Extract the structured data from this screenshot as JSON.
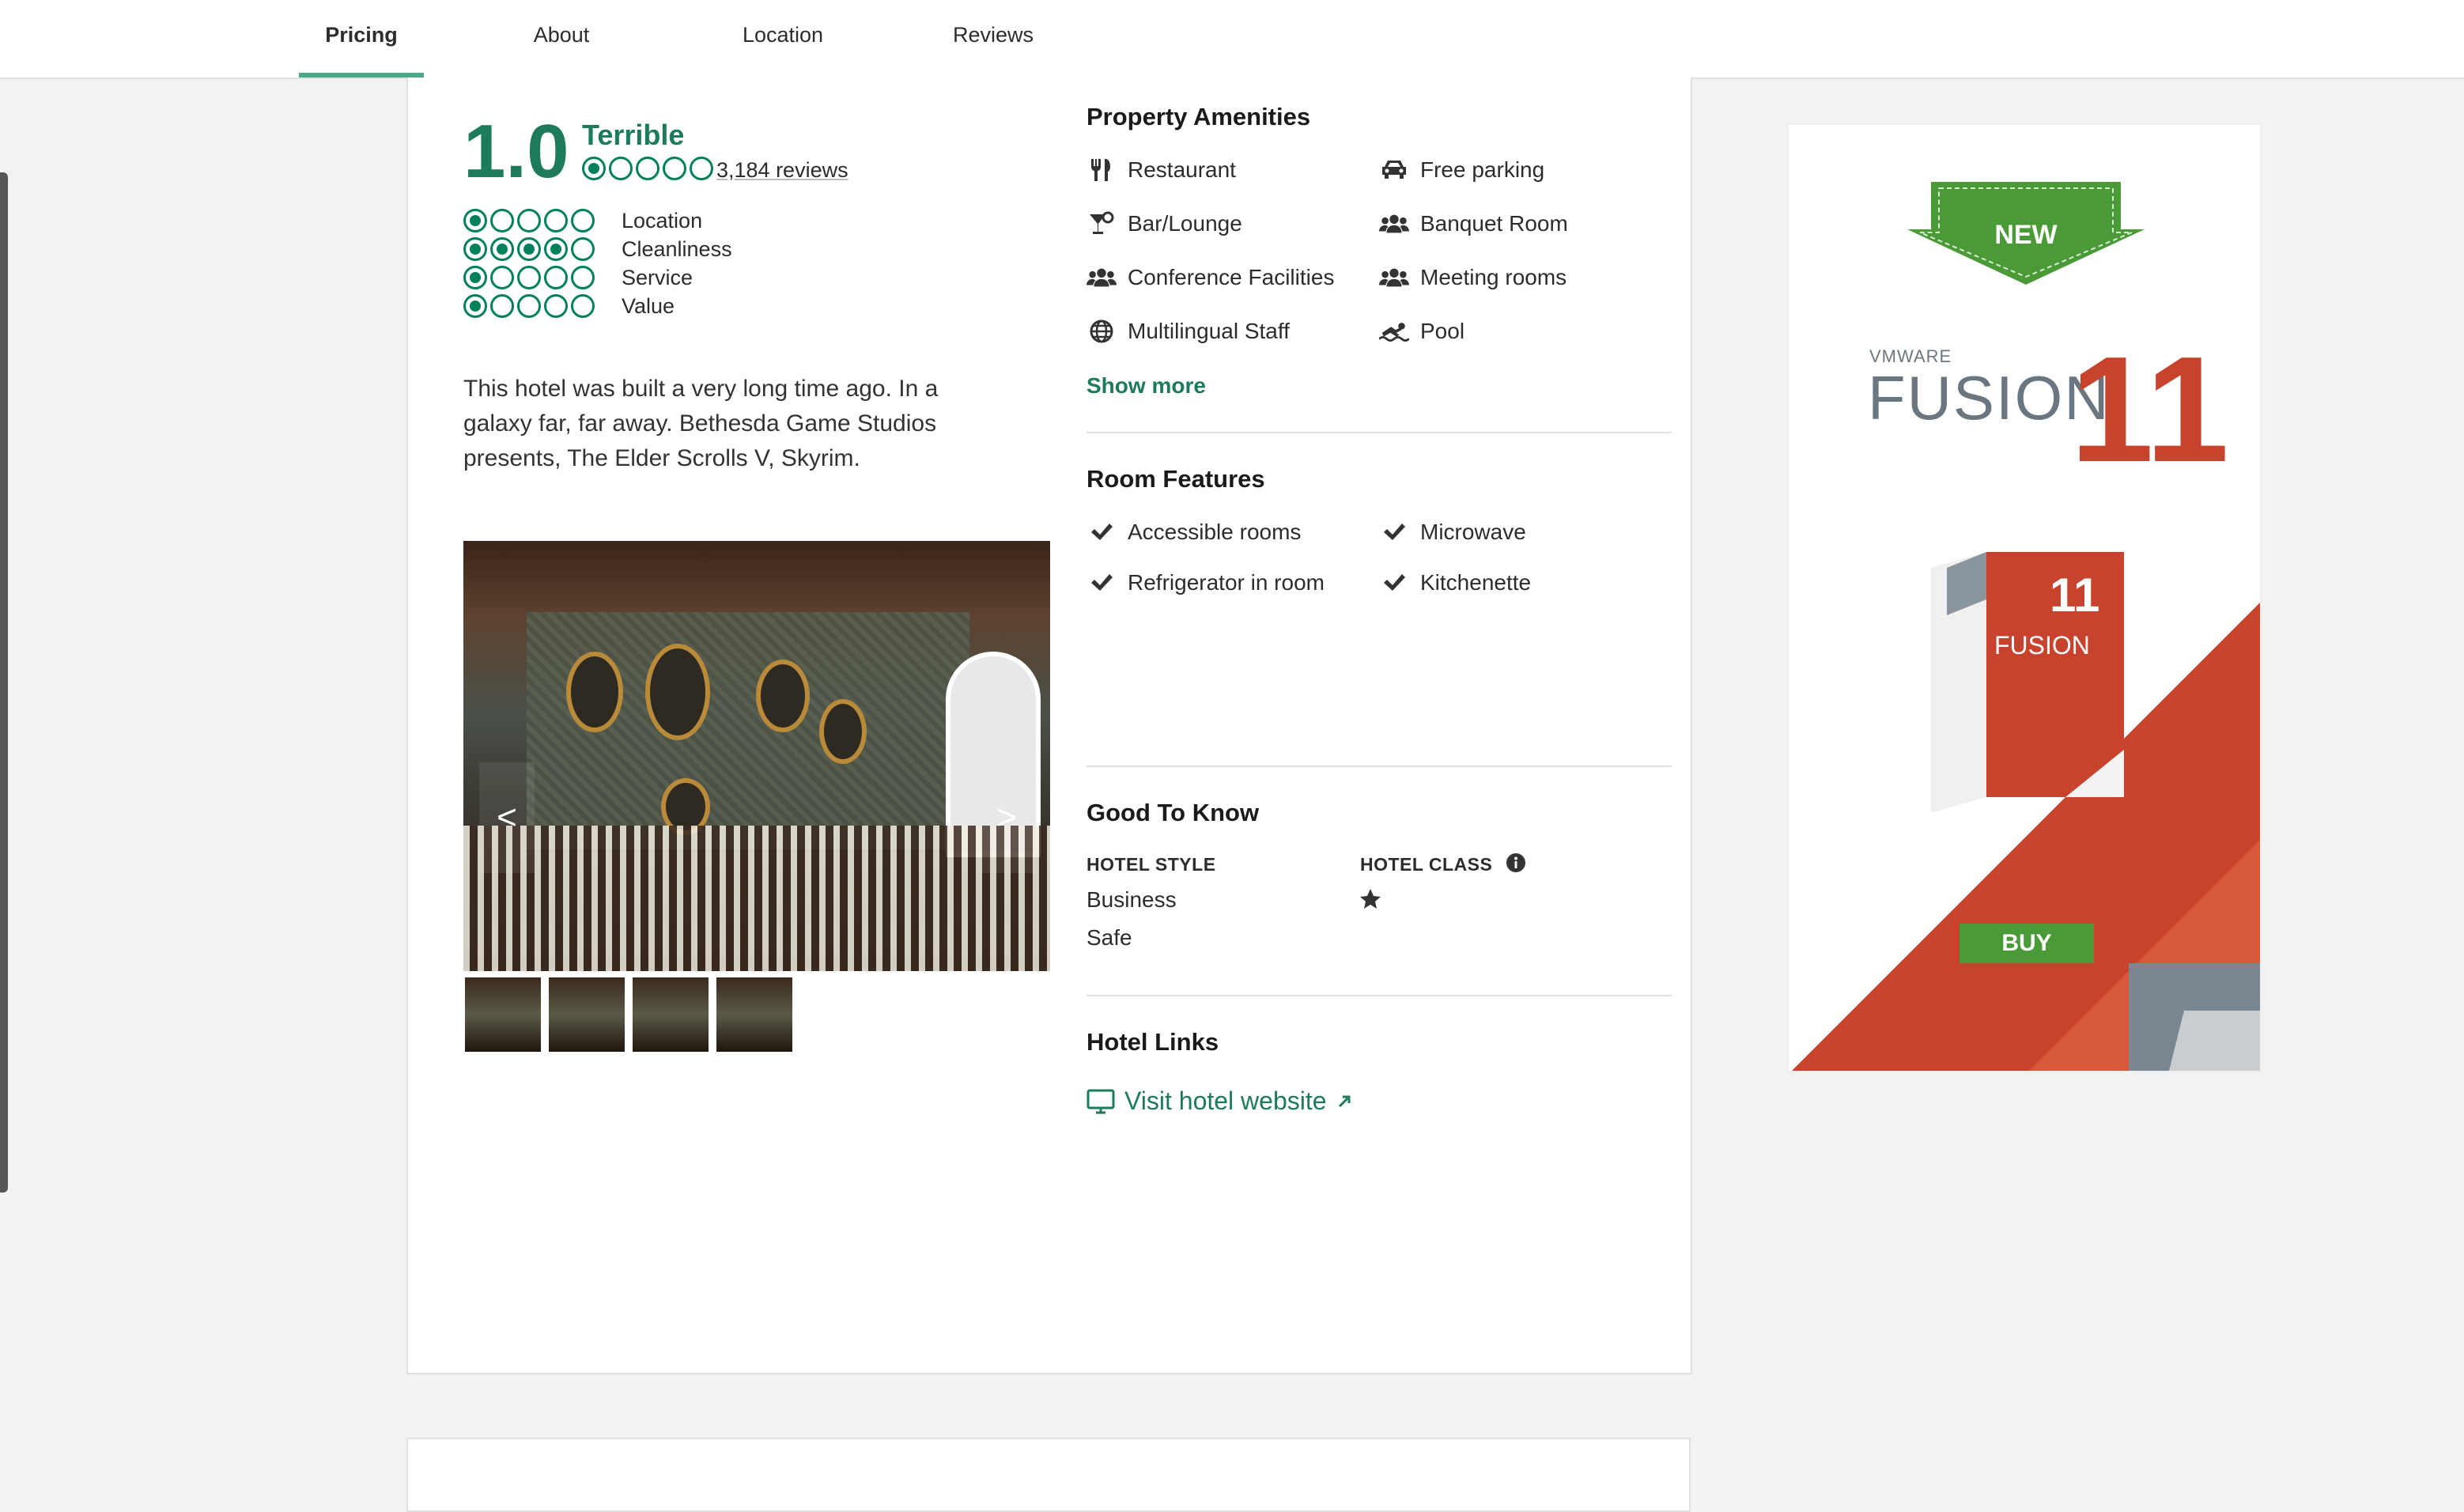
{
  "tabs": [
    {
      "label": "Pricing",
      "active": true
    },
    {
      "label": "About",
      "active": false
    },
    {
      "label": "Location",
      "active": false
    },
    {
      "label": "Reviews",
      "active": false
    }
  ],
  "rating": {
    "score": "1.0",
    "word": "Terrible",
    "bubbles_filled": 1,
    "reviews": "3,184 reviews",
    "subratings": [
      {
        "label": "Location",
        "value": 1
      },
      {
        "label": "Cleanliness",
        "value": 4
      },
      {
        "label": "Service",
        "value": 1
      },
      {
        "label": "Value",
        "value": 1
      }
    ]
  },
  "description": "This hotel was built a very long time ago. In a galaxy far, far away. Bethesda Game Studios presents, The Elder Scrolls V, Skyrim.",
  "gallery": {
    "prev": "<",
    "next": ">"
  },
  "amenities": {
    "title": "Property Amenities",
    "items": [
      {
        "label": "Restaurant",
        "icon": "restaurant-icon"
      },
      {
        "label": "Free parking",
        "icon": "car-icon"
      },
      {
        "label": "Bar/Lounge",
        "icon": "cocktail-icon"
      },
      {
        "label": "Banquet Room",
        "icon": "people-icon"
      },
      {
        "label": "Conference Facilities",
        "icon": "people-icon"
      },
      {
        "label": "Meeting rooms",
        "icon": "people-icon"
      },
      {
        "label": "Multilingual Staff",
        "icon": "globe-icon"
      },
      {
        "label": "Pool",
        "icon": "swimmer-icon"
      }
    ],
    "show_more": "Show more"
  },
  "room_features": {
    "title": "Room Features",
    "items": [
      "Accessible rooms",
      "Microwave",
      "Refrigerator in room",
      "Kitchenette"
    ]
  },
  "good_to_know": {
    "title": "Good To Know",
    "style_label": "HOTEL STYLE",
    "style_values": [
      "Business",
      "Safe"
    ],
    "class_label": "HOTEL CLASS",
    "class_stars": 1
  },
  "hotel_links": {
    "title": "Hotel Links",
    "website": "Visit hotel website"
  },
  "ad": {
    "badge": "NEW",
    "brand_small": "VMWARE",
    "brand": "FUSION",
    "version": "11",
    "buy": "BUY",
    "colors": {
      "green": "#4a9a38",
      "red": "#c8432d",
      "gray": "#6b7780"
    }
  }
}
